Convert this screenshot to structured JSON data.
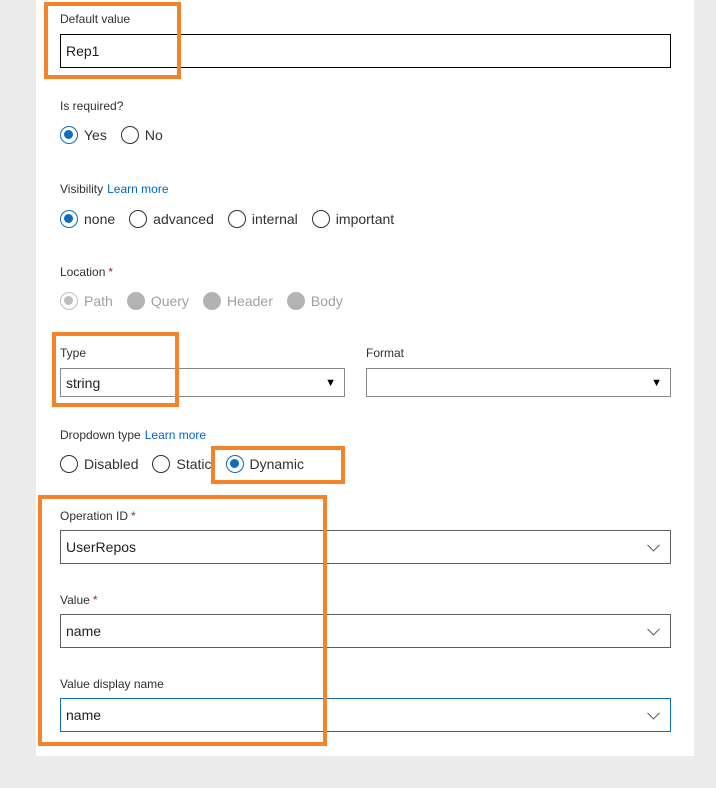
{
  "default_value": {
    "label": "Default value",
    "value": "Rep1"
  },
  "is_required": {
    "label": "Is required?",
    "options": [
      "Yes",
      "No"
    ],
    "selected": "Yes"
  },
  "visibility": {
    "label": "Visibility",
    "link": "Learn more",
    "options": [
      "none",
      "advanced",
      "internal",
      "important"
    ],
    "selected": "none"
  },
  "location": {
    "label": "Location",
    "required_mark": "*",
    "options": [
      "Path",
      "Query",
      "Header",
      "Body"
    ],
    "selected": "Path",
    "disabled": true
  },
  "type": {
    "label": "Type",
    "value": "string"
  },
  "format": {
    "label": "Format",
    "value": ""
  },
  "dropdown_type": {
    "label": "Dropdown type",
    "link": "Learn more",
    "options": [
      "Disabled",
      "Static",
      "Dynamic"
    ],
    "selected": "Dynamic"
  },
  "operation_id": {
    "label": "Operation ID",
    "required_mark": "*",
    "value": "UserRepos"
  },
  "value_field": {
    "label": "Value",
    "required_mark": "*",
    "value": "name"
  },
  "value_display_name": {
    "label": "Value display name",
    "value": "name"
  },
  "colors": {
    "accent": "#0f6cbd",
    "highlight": "#f5832a",
    "required": "#a4262c"
  }
}
